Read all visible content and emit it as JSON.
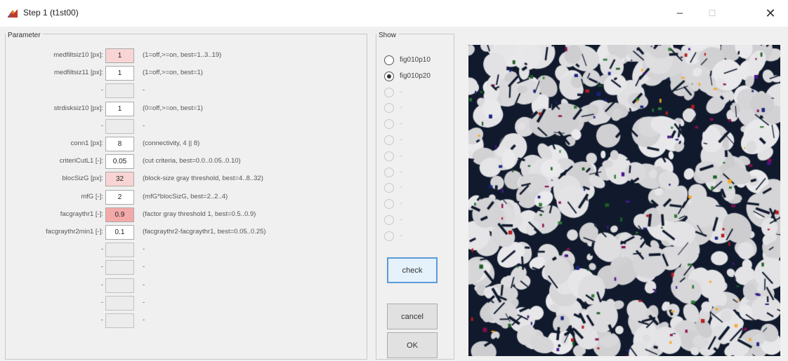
{
  "window": {
    "title": "Step 1 (t1st00)",
    "minimize": "–",
    "maximize": "☐",
    "close": "✕"
  },
  "parameter_panel": {
    "title": "Parameter",
    "rows": [
      {
        "label": "medfiltsiz10 [px]:",
        "value": "1",
        "desc": "(1=off,>=on, best=1..3..19)",
        "state": "pink"
      },
      {
        "label": "medfiltsiz11 [px]:",
        "value": "1",
        "desc": "(1=off,>=on, best=1)",
        "state": "normal"
      },
      {
        "label": "-",
        "value": "",
        "desc": "-",
        "state": "empty"
      },
      {
        "label": "strdisksiz10 [px]:",
        "value": "1",
        "desc": "(0=off,>=on, best=1)",
        "state": "normal"
      },
      {
        "label": "-",
        "value": "",
        "desc": "-",
        "state": "empty"
      },
      {
        "label": "conn1 [px]:",
        "value": "8",
        "desc": "(connectivity, 4 || 8)",
        "state": "normal"
      },
      {
        "label": "criteriCutL1 [-]:",
        "value": "0.05",
        "desc": "(cut criteria, best=0.0..0.05..0.10)",
        "state": "normal"
      },
      {
        "label": "blocSizG [px]:",
        "value": "32",
        "desc": "(block-size gray threshold, best=4..8..32)",
        "state": "pink"
      },
      {
        "label": "mfG [-]:",
        "value": "2",
        "desc": "(mfG*blocSizG, best=2..2..4)",
        "state": "normal"
      },
      {
        "label": "facgraythr1 [-]:",
        "value": "0.9",
        "desc": "(factor gray threshold 1, best=0.5..0.9)",
        "state": "red"
      },
      {
        "label": "facgraythr2min1 [-]:",
        "value": "0.1",
        "desc": "(facgraythr2-facgraythr1, best=0.05..0.25)",
        "state": "normal"
      },
      {
        "label": "-",
        "value": "",
        "desc": "-",
        "state": "empty"
      },
      {
        "label": "-",
        "value": "",
        "desc": "-",
        "state": "empty"
      },
      {
        "label": "-",
        "value": "",
        "desc": "-",
        "state": "empty"
      },
      {
        "label": "-",
        "value": "",
        "desc": "-",
        "state": "empty"
      },
      {
        "label": "-",
        "value": "",
        "desc": "-",
        "state": "empty"
      }
    ]
  },
  "show_panel": {
    "title": "Show",
    "options": [
      {
        "label": "fig010p10",
        "selected": false,
        "enabled": true
      },
      {
        "label": "fig010p20",
        "selected": true,
        "enabled": true
      },
      {
        "label": "-",
        "selected": false,
        "enabled": false
      },
      {
        "label": "-",
        "selected": false,
        "enabled": false
      },
      {
        "label": "-",
        "selected": false,
        "enabled": false
      },
      {
        "label": "-",
        "selected": false,
        "enabled": false
      },
      {
        "label": "-",
        "selected": false,
        "enabled": false
      },
      {
        "label": "-",
        "selected": false,
        "enabled": false
      },
      {
        "label": "-",
        "selected": false,
        "enabled": false
      },
      {
        "label": "-",
        "selected": false,
        "enabled": false
      },
      {
        "label": "-",
        "selected": false,
        "enabled": false
      },
      {
        "label": "-",
        "selected": false,
        "enabled": false
      }
    ]
  },
  "buttons": {
    "check": "check",
    "cancel": "cancel",
    "ok": "OK"
  },
  "colors": {
    "pink_field": "#f9d4d4",
    "red_field": "#f4a9a9",
    "preview_dark": "#101a2c",
    "preview_light": "#d9d9dc"
  }
}
